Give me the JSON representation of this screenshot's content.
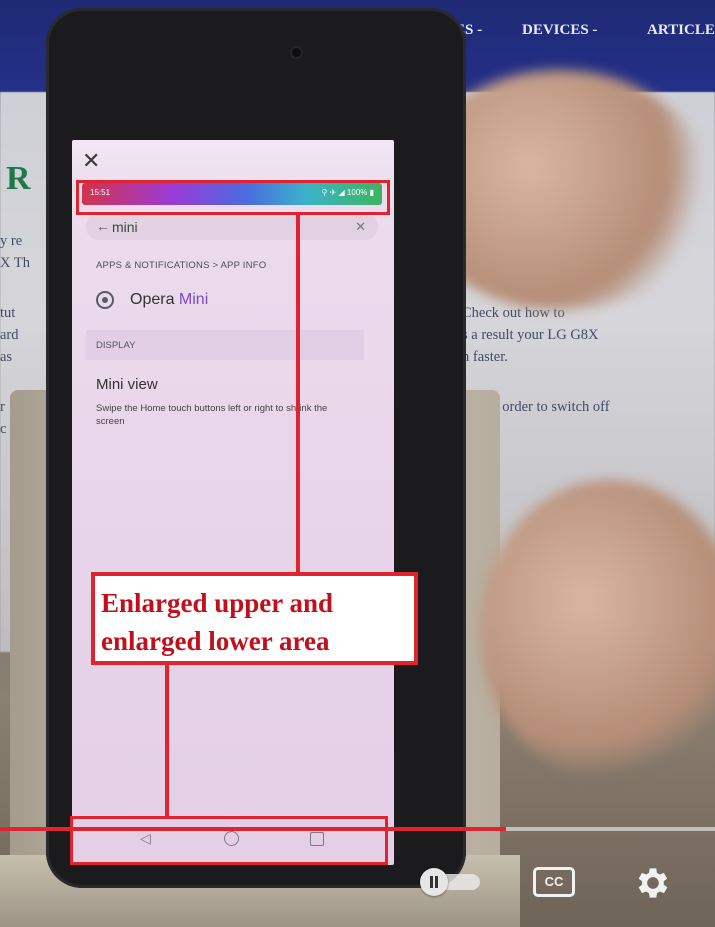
{
  "website": {
    "nav_items": [
      "ES -",
      "DEVICES -",
      "ARTICLE"
    ],
    "title_fragment": "R",
    "left_lines": [
      "y re",
      "X Th",
      "tut",
      "ard",
      "as",
      "r",
      "c"
    ],
    "right_lines": [
      "Check out how to",
      "s a result your LG G8X",
      "n faster.",
      "hile in order to switch off"
    ]
  },
  "phone_screen": {
    "close_icon": "close-icon",
    "status_time": "15:51",
    "status_right": "⚲ ✈ ◢ 100% ▮",
    "search_query": "mini",
    "breadcrumb": "APPS & NOTIFICATIONS > APP INFO",
    "result": {
      "prefix": "Opera ",
      "highlight": "Mini"
    },
    "section_header": "DISPLAY",
    "setting_title_prefix": "Mini ",
    "setting_title_rest": "view",
    "setting_description": "Swipe the Home touch buttons left or right to shrink the screen",
    "nav_buttons": [
      "back-icon",
      "home-icon",
      "recents-icon"
    ]
  },
  "annotation": {
    "label": "Enlarged upper and\nenlarged lower area",
    "color": "#e0242f"
  },
  "video_controls": {
    "progress": 0.708,
    "cc_label": "CC",
    "autoplay_toggle": "pause-toggle",
    "settings_icon": "gear-icon"
  }
}
